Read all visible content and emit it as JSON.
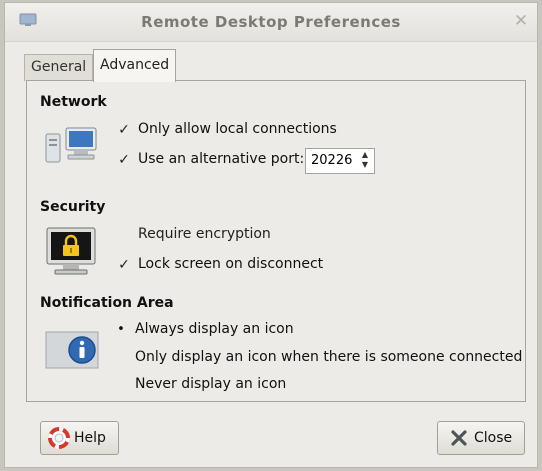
{
  "window": {
    "title": "Remote Desktop Preferences",
    "close_glyph": "✕"
  },
  "tabs": [
    {
      "label": "General",
      "selected": false
    },
    {
      "label": "Advanced",
      "selected": true
    }
  ],
  "network": {
    "heading": "Network",
    "icon": "network-computers-icon",
    "local_only": {
      "label": "Only allow local connections",
      "checked": true
    },
    "alt_port": {
      "label": "Use an alternative port:",
      "checked": true,
      "value": "20226"
    }
  },
  "security": {
    "heading": "Security",
    "icon": "monitor-lock-icon",
    "require_encryption": {
      "label": "Require encryption",
      "checked": false
    },
    "lock_screen": {
      "label": "Lock screen on disconnect",
      "checked": true
    }
  },
  "notification": {
    "heading": "Notification Area",
    "icon": "info-icon",
    "options": [
      {
        "label": "Always display an icon",
        "selected": true
      },
      {
        "label": "Only display an icon when there is someone connected",
        "selected": false
      },
      {
        "label": "Never display an icon",
        "selected": false
      }
    ]
  },
  "buttons": {
    "help": "Help",
    "close": "Close"
  },
  "colors": {
    "info_blue": "#2f6ab3",
    "lifebuoy_red": "#d7382c"
  }
}
